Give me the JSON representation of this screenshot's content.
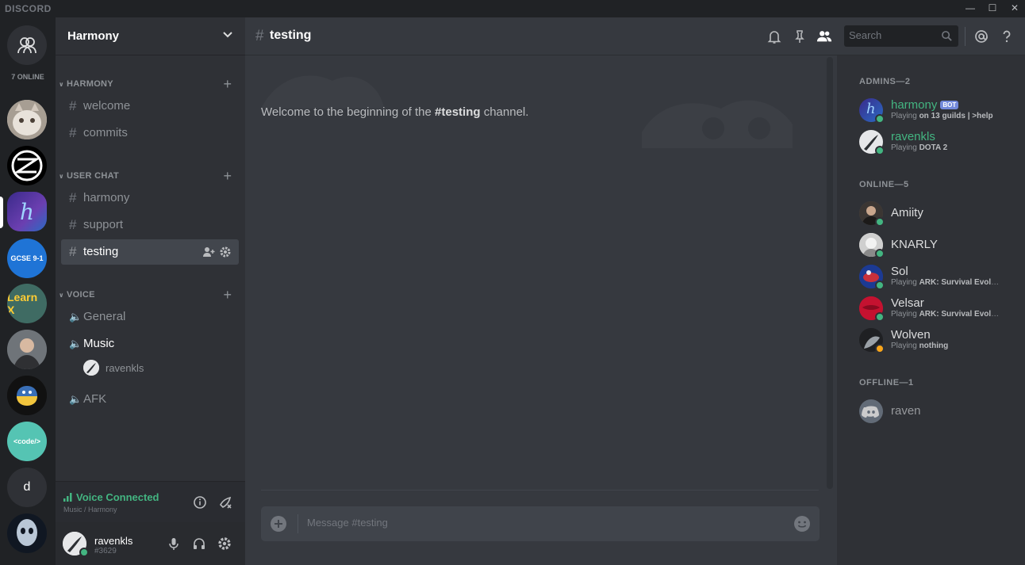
{
  "window": {
    "brand": "DISCORD"
  },
  "servers": {
    "online_count": "7 ONLINE",
    "gcse_label": "GCSE 9-1",
    "learn_label": "Learn X",
    "code_label": "<code/>",
    "d_label": "d"
  },
  "guild": {
    "name": "Harmony"
  },
  "categories": [
    {
      "label": "HARMONY",
      "channels": [
        {
          "name": "welcome"
        },
        {
          "name": "commits"
        }
      ]
    },
    {
      "label": "USER CHAT",
      "channels": [
        {
          "name": "harmony"
        },
        {
          "name": "support"
        },
        {
          "name": "testing",
          "active": true
        }
      ]
    },
    {
      "label": "VOICE",
      "channels": [
        {
          "name": "General"
        },
        {
          "name": "Music",
          "user": "ravenkls"
        },
        {
          "name": "AFK"
        }
      ]
    }
  ],
  "voice_panel": {
    "title": "Voice Connected",
    "subtitle": "Music / Harmony"
  },
  "user_panel": {
    "name": "ravenkls",
    "tag": "#3629"
  },
  "chat": {
    "channel_name": "testing",
    "search_placeholder": "Search",
    "welcome_prefix": "Welcome to the beginning of the ",
    "welcome_channel": "#testing",
    "welcome_suffix": " channel.",
    "composer_placeholder": "Message #testing"
  },
  "members": {
    "groups": [
      {
        "header": "ADMINS—2",
        "members": [
          {
            "name": "harmony",
            "bot_tag": "BOT",
            "playing_prefix": "Playing ",
            "game": "on 13 guilds | >help",
            "status": "online"
          },
          {
            "name": "ravenkls",
            "playing_prefix": "Playing ",
            "game": "DOTA 2",
            "status": "online"
          }
        ]
      },
      {
        "header": "ONLINE—5",
        "members": [
          {
            "name": "Amiity",
            "status": "online"
          },
          {
            "name": "KNARLY",
            "status": "online"
          },
          {
            "name": "Sol",
            "playing_prefix": "Playing ",
            "game": "ARK: Survival Evolve…",
            "status": "online"
          },
          {
            "name": "Velsar",
            "playing_prefix": "Playing ",
            "game": "ARK: Survival Evolve…",
            "status": "online"
          },
          {
            "name": "Wolven",
            "playing_prefix": "Playing ",
            "game": "nothing",
            "status": "idle"
          }
        ]
      },
      {
        "header": "OFFLINE—1",
        "members": [
          {
            "name": "raven",
            "status": "offline"
          }
        ]
      }
    ]
  },
  "colors": {
    "online": "#43b581",
    "idle": "#faa61a",
    "accent": "#7289da",
    "background": "#36393f"
  }
}
